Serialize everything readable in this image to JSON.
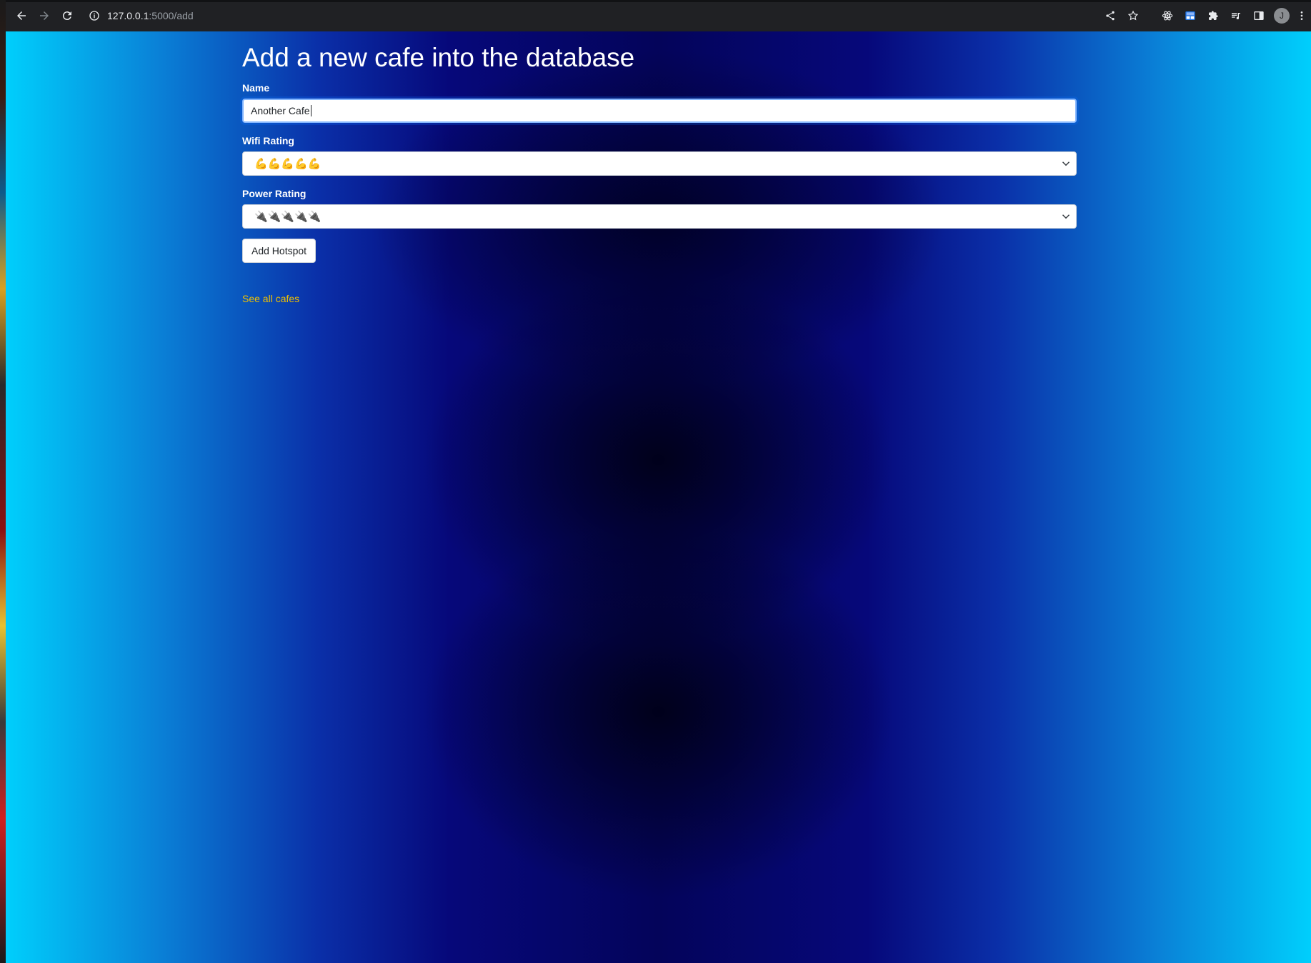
{
  "browser": {
    "url_host": "127.0.0.1",
    "url_rest": ":5000/add",
    "profile_initial": "J"
  },
  "page": {
    "title": "Add a new cafe into the database",
    "form": {
      "name": {
        "label": "Name",
        "value": "Another Cafe"
      },
      "wifi": {
        "label": "Wifi Rating",
        "selected": "💪💪💪💪💪"
      },
      "power": {
        "label": "Power Rating",
        "selected": "🔌🔌🔌🔌🔌"
      },
      "submit_label": "Add Hotspot"
    },
    "link_text": "See all cafes"
  },
  "colors": {
    "link": "#f0c000",
    "edge_gradient": "#00cffc",
    "center_gradient": "#04045a"
  }
}
